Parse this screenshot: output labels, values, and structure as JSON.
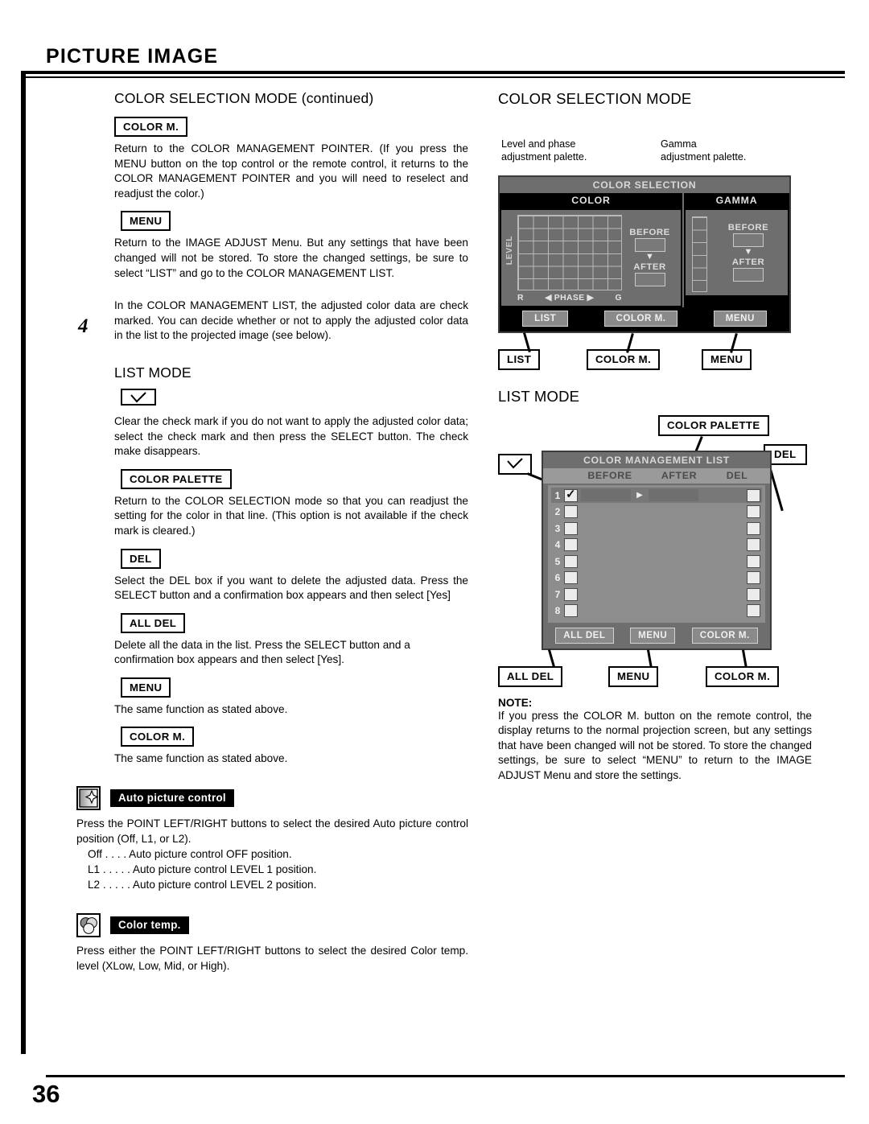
{
  "header": {
    "chapter": "PICTURE IMAGE"
  },
  "footer": {
    "page_number": "36"
  },
  "left_column": {
    "section_title": "COLOR SELECTION MODE (continued)",
    "entries": [
      {
        "key": "COLOR M.",
        "text": "Return to the COLOR MANAGEMENT POINTER. (If you press the MENU button on the top control or the remote control, it returns to the COLOR MANAGEMENT POINTER and you will need to reselect and readjust the color.)"
      },
      {
        "key": "MENU",
        "text": "Return to the IMAGE ADJUST Menu. But any settings that have been changed will not be stored. To store the changed settings, be sure to select “LIST” and go to the COLOR MANAGEMENT LIST."
      }
    ],
    "step": {
      "number": "4",
      "text": "In the COLOR MANAGEMENT LIST, the adjusted color data are check marked. You can decide whether or not to apply the adjusted color data in the list to the projected image (see below)."
    },
    "list_mode_title": "LIST MODE",
    "list_entries": [
      {
        "key": "check-mark-icon",
        "key_type": "check",
        "text": "Clear the check mark if you do not want to apply the adjusted color data; select the check mark and then press the SELECT button. The check make disappears."
      },
      {
        "key": "COLOR PALETTE",
        "key_type": "text",
        "text": "Return to the COLOR SELECTION mode so that you can readjust the setting for the color in that line. (This option is not available if the check mark is cleared.)"
      },
      {
        "key": "DEL",
        "key_type": "text",
        "text": "Select the DEL box if you want to delete the adjusted data. Press the SELECT button and a confirmation box appears and then select [Yes]"
      },
      {
        "key": "ALL DEL",
        "key_type": "text",
        "text": "Delete all the data in the list. Press the SELECT button and a confirmation box appears and then select [Yes]."
      },
      {
        "key": "MENU",
        "key_type": "text",
        "text": "The same function as stated above."
      },
      {
        "key": "COLOR M.",
        "key_type": "text",
        "text": "The same function as stated above."
      }
    ],
    "feature_auto": {
      "icon": "auto-picture-control-icon",
      "chip_label": "Auto picture control",
      "text": "Press the POINT LEFT/RIGHT buttons to select the desired Auto picture control position (Off, L1, or L2).",
      "options": [
        "Off  . . . . Auto picture control OFF position.",
        "L1 . . . . . Auto picture control LEVEL 1 position.",
        "L2 . . . . . Auto picture control LEVEL 2 position."
      ]
    },
    "feature_temp": {
      "icon": "color-temp-icon",
      "chip_label": "Color temp.",
      "text": "Press either the POINT LEFT/RIGHT buttons to select the desired Color temp. level (XLow, Low, Mid, or High)."
    }
  },
  "right_column": {
    "section_title": "COLOR SELECTION MODE",
    "annotations": {
      "level_phase": "Level and phase\nadjustment palette.",
      "level_phase_l1": "Level and phase",
      "level_phase_l2": "adjustment palette.",
      "gamma_l1": "Gamma",
      "gamma_l2": "adjustment palette."
    },
    "color_selection_osd": {
      "title": "COLOR SELECTION",
      "color_panel": {
        "heading": "COLOR",
        "level_axis": "LEVEL",
        "phase_left_icon": "triangle-left-icon",
        "phase_label": "PHASE",
        "phase_right_icon": "triangle-right-icon",
        "axis_start": "R",
        "axis_end": "G",
        "before_label": "BEFORE",
        "after_label": "AFTER",
        "arrow_icon": "triangle-down-icon"
      },
      "gamma_panel": {
        "heading": "GAMMA",
        "before_label": "BEFORE",
        "after_label": "AFTER",
        "arrow_icon": "triangle-down-icon"
      },
      "buttons": [
        "LIST",
        "COLOR M.",
        "MENU"
      ]
    },
    "color_selection_callouts": [
      "LIST",
      "COLOR M.",
      "MENU"
    ],
    "list_mode_title": "LIST MODE",
    "list_callouts": {
      "color_palette": "COLOR PALETTE",
      "del": "DEL",
      "check": "check-mark-icon"
    },
    "color_management_osd": {
      "title": "COLOR MANAGEMENT LIST",
      "columns": [
        "BEFORE",
        "AFTER",
        "DEL"
      ],
      "rows": [
        {
          "num": "1",
          "checked": true
        },
        {
          "num": "2",
          "checked": false
        },
        {
          "num": "3",
          "checked": false
        },
        {
          "num": "4",
          "checked": false
        },
        {
          "num": "5",
          "checked": false
        },
        {
          "num": "6",
          "checked": false
        },
        {
          "num": "7",
          "checked": false
        },
        {
          "num": "8",
          "checked": false
        }
      ],
      "buttons": [
        "ALL DEL",
        "MENU",
        "COLOR M."
      ]
    },
    "list_bottom_callouts": [
      "ALL DEL",
      "MENU",
      "COLOR M."
    ],
    "note": {
      "heading": "NOTE:",
      "text": "If you press the COLOR M. button on the remote control, the display returns to the normal projection screen, but any settings that have been changed will not be stored. To store the changed settings, be sure to select “MENU” to return to the IMAGE ADJUST Menu and store the settings."
    }
  },
  "colors": {
    "osd_body": "#6e6e6e",
    "osd_panel_bg": "#000000",
    "osd_text": "#dcdcdc",
    "list_header": "#9a9a9a",
    "ink": "#000000"
  }
}
